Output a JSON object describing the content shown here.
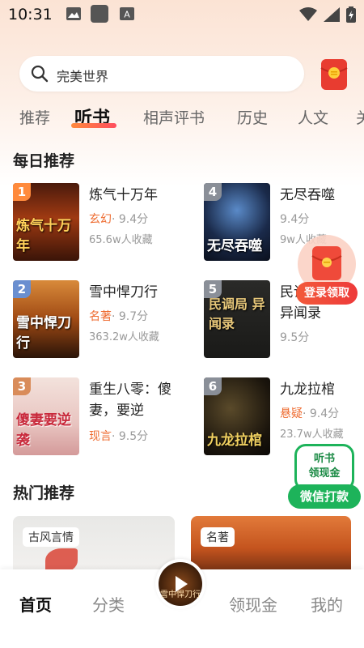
{
  "status_bar": {
    "time": "10:31"
  },
  "search": {
    "text": "完美世界"
  },
  "tabs": [
    "推荐",
    "听书",
    "相声评书",
    "历史",
    "人文",
    "关"
  ],
  "active_tab": "听书",
  "daily": {
    "title": "每日推荐",
    "books": [
      {
        "rank": "1",
        "title": "炼气十万年",
        "genre": "玄幻",
        "score": "· 9.4分",
        "fav": "65.6w人收藏",
        "cover_text": "炼气十万年",
        "rank_color": "#ff8a3c"
      },
      {
        "rank": "4",
        "title": "无尽吞噬",
        "genre": "",
        "score": "9.4分",
        "fav": "9w人收藏",
        "cover_text": "无尽吞噬",
        "rank_color": "#8a8f98"
      },
      {
        "rank": "2",
        "title": "雪中悍刀行",
        "genre": "名著",
        "score": "· 9.7分",
        "fav": "363.2w人收藏",
        "cover_text": "雪中悍刀行",
        "rank_color": "#6a8fd0"
      },
      {
        "rank": "5",
        "title": "民调局异闻录",
        "genre": "",
        "score": "9.5分",
        "fav": "",
        "cover_text": "民调局 异闻录",
        "rank_color": "#8a8f98"
      },
      {
        "rank": "3",
        "title": "重生八零：傻妻，要逆",
        "genre": "现言",
        "score": "· 9.5分",
        "fav": "",
        "cover_text": "傻妻要逆袭",
        "rank_color": "#d98c5a"
      },
      {
        "rank": "6",
        "title": "九龙拉棺",
        "genre": "悬疑",
        "score": "· 9.4分",
        "fav": "23.7w人收藏",
        "cover_text": "九龙拉棺",
        "rank_color": "#8a8f98"
      }
    ]
  },
  "float_red": {
    "label": "登录领取"
  },
  "float_green": {
    "line1": "听书",
    "line2": "领现金",
    "button": "微信打款"
  },
  "hot": {
    "title": "热门推荐",
    "cards": [
      {
        "tag": "古风言情"
      },
      {
        "tag": "名著"
      }
    ]
  },
  "bottom_nav": [
    "首页",
    "分类",
    "领现金",
    "我的"
  ],
  "player": {
    "cover_text": "雪中悍刀行"
  },
  "colors": {
    "accent": "#ee6a2e",
    "green": "#1db35a",
    "red": "#e8433a"
  }
}
